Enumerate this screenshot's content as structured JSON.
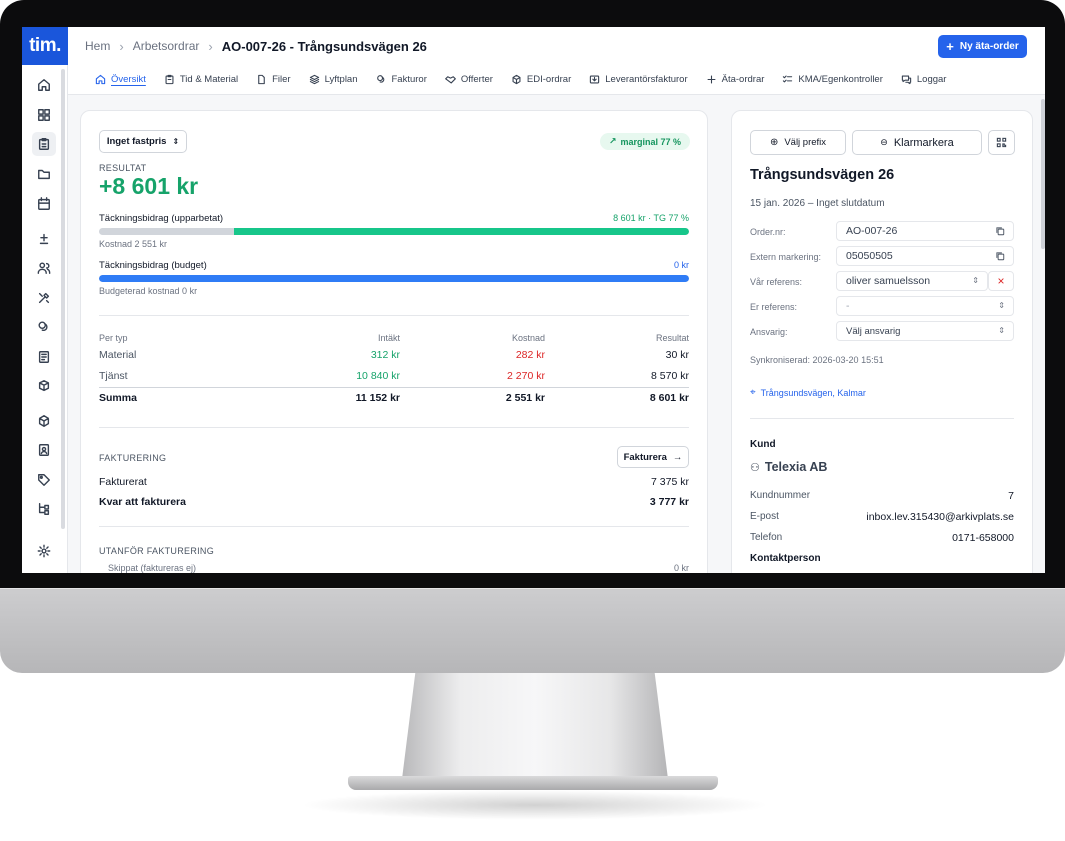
{
  "app": {
    "logo": "tim."
  },
  "breadcrumb": {
    "home": "Hem",
    "section": "Arbetsordrar",
    "current": "AO-007-26 - Trångsundsvägen 26",
    "sep": "›"
  },
  "header": {
    "new_button": "Ny äta-order",
    "new_icon": "plus-icon"
  },
  "tabs": [
    {
      "label": "Översikt",
      "icon": "home-icon"
    },
    {
      "label": "Tid & Material",
      "icon": "clipboard-icon"
    },
    {
      "label": "Filer",
      "icon": "file-icon"
    },
    {
      "label": "Lyftplan",
      "icon": "layers-icon"
    },
    {
      "label": "Fakturor",
      "icon": "coins-icon"
    },
    {
      "label": "Offerter",
      "icon": "handshake-icon"
    },
    {
      "label": "EDI-ordrar",
      "icon": "box-icon"
    },
    {
      "label": "Leverantörsfakturor",
      "icon": "inbox-icon"
    },
    {
      "label": "Äta-ordrar",
      "icon": "plus-icon"
    },
    {
      "label": "KMA/Egenkontroller",
      "icon": "checklist-icon"
    },
    {
      "label": "Loggar",
      "icon": "chat-icon"
    }
  ],
  "economy": {
    "price_select": "Inget fastpris",
    "margin_pill": "marginal 77 %",
    "result_caption": "RESULTAT",
    "result_value": "+8 601 kr",
    "tb_actual": {
      "label": "Täckningsbidrag (upparbetat)",
      "right": "8 601 kr · TG 77 %",
      "sub": "Kostnad 2 551 kr",
      "fill_fraction": 0.77
    },
    "tb_budget": {
      "label": "Täckningsbidrag (budget)",
      "right": "0 kr",
      "sub": "Budgeterad kostnad 0 kr",
      "fill_fraction": 1.0
    },
    "table": {
      "headers": [
        "Per typ",
        "Intäkt",
        "Kostnad",
        "Resultat"
      ],
      "rows": [
        {
          "type": "Material",
          "income": "312 kr",
          "cost": "282 kr",
          "result": "30 kr"
        },
        {
          "type": "Tjänst",
          "income": "10 840 kr",
          "cost": "2 270 kr",
          "result": "8 570 kr"
        }
      ],
      "total": {
        "type": "Summa",
        "income": "11 152 kr",
        "cost": "2 551 kr",
        "result": "8 601 kr"
      }
    },
    "billing": {
      "caption": "FAKTURERING",
      "button": "Fakturera",
      "invoiced_label": "Fakturerat",
      "invoiced_value": "7 375 kr",
      "remaining_label": "Kvar att fakturera",
      "remaining_value": "3 777 kr"
    },
    "outside": {
      "caption": "UTANFÖR FAKTURERING",
      "skipped_label": "Skippat (faktureras ej)",
      "skipped_value": "0 kr"
    }
  },
  "order": {
    "prefix_button": "Välj prefix",
    "mark_button": "Klarmarkera",
    "title": "Trångsundsvägen 26",
    "dates": "15 jan. 2026 – Inget slutdatum",
    "fields": [
      {
        "label": "Order.nr:",
        "value": "AO-007-26",
        "kind": "copy"
      },
      {
        "label": "Extern markering:",
        "value": "05050505",
        "kind": "copy"
      },
      {
        "label": "Vår referens:",
        "value": "oliver samuelsson",
        "kind": "select-clear"
      },
      {
        "label": "Er referens:",
        "value": "-",
        "kind": "select"
      },
      {
        "label": "Ansvarig:",
        "value": "Välj ansvarig",
        "kind": "select"
      }
    ],
    "synced": "Synkroniserad: 2026-03-20 15:51",
    "address_link": "Trångsundsvägen, Kalmar",
    "customer": {
      "caption": "Kund",
      "name": "Telexia AB",
      "rows": [
        {
          "label": "Kundnummer",
          "value": "7"
        },
        {
          "label": "E-post",
          "value": "inbox.lev.315430@arkivplats.se"
        },
        {
          "label": "Telefon",
          "value": "0171-658000"
        }
      ],
      "contact_caption": "Kontaktperson"
    }
  },
  "colors": {
    "brand": "#1a56db",
    "accent": "#2563eb",
    "positive": "#16a36a",
    "negative": "#dc2626",
    "bar_green": "#17c68a",
    "bar_blue": "#2f7cf6"
  }
}
